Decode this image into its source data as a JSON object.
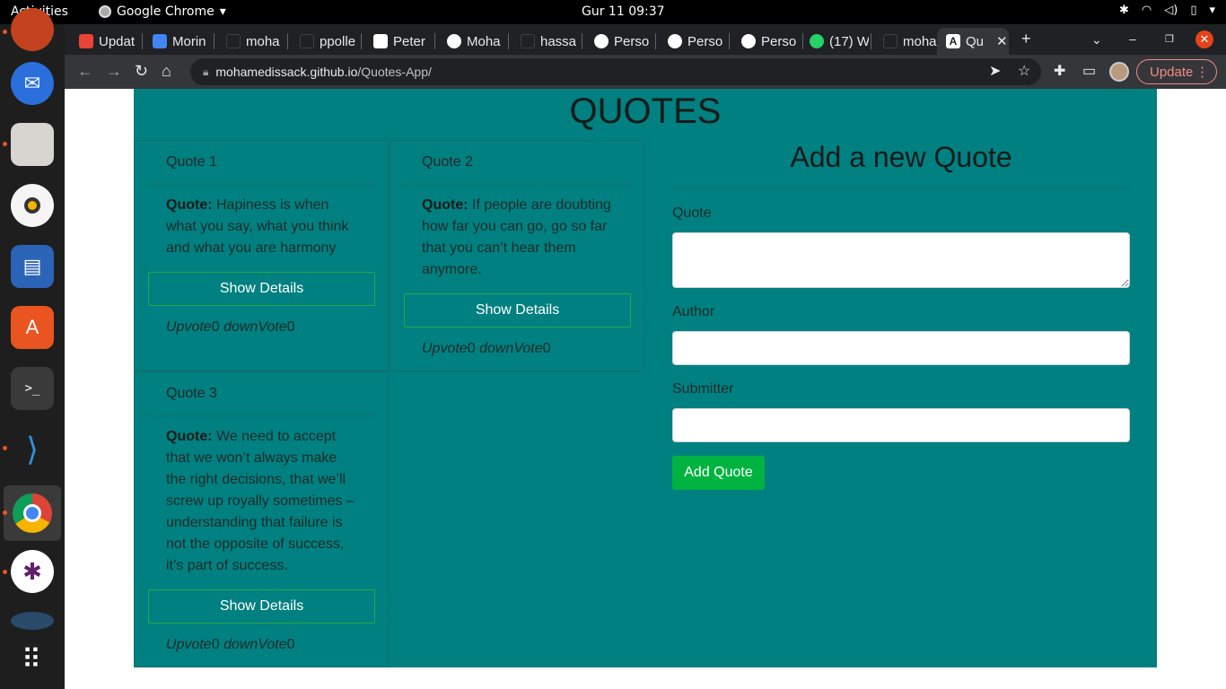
{
  "topbar": {
    "activities": "Activities",
    "app_name": "Google Chrome",
    "clock": "Gur 11  09:37"
  },
  "dock": {
    "items": [
      "firefox-icon",
      "thunderbird-icon",
      "files-icon",
      "rhythmbox-icon",
      "writer-icon",
      "software-icon",
      "terminal-icon",
      "vscode-icon",
      "chrome-icon",
      "slack-icon",
      "apps-grid-icon"
    ]
  },
  "browser": {
    "tabs": [
      {
        "label": "Updat",
        "color": "#ea4335"
      },
      {
        "label": "Morin",
        "color": "#4285f4"
      },
      {
        "label": "moha",
        "color": "#202124"
      },
      {
        "label": "ppolle",
        "color": "#202124"
      },
      {
        "label": "Peter",
        "color": "#ffffff"
      },
      {
        "label": "Moha",
        "color": "#ffffff"
      },
      {
        "label": "hassa",
        "color": "#202124"
      },
      {
        "label": "Perso",
        "color": "#ffffff"
      },
      {
        "label": "Perso",
        "color": "#ffffff"
      },
      {
        "label": "Perso",
        "color": "#ffffff"
      },
      {
        "label": "(17) W",
        "color": "#25d366"
      },
      {
        "label": "moha",
        "color": "#202124"
      },
      {
        "label": "Qu",
        "color": "#ffffff",
        "active": true
      }
    ],
    "url_host": "mohamedissack.github.io",
    "url_path": "/Quotes-App/",
    "update_label": "Update"
  },
  "app": {
    "title": "QUOTES",
    "details_label": "Show Details",
    "quote_prefix": "Quote:",
    "upvote_label": "Upvote",
    "downvote_label": "downVote",
    "quotes": [
      {
        "title": "Quote 1",
        "text": "Hapiness is when what you say, what you think and what you are harmony",
        "upvotes": "0",
        "downvotes": "0"
      },
      {
        "title": "Quote 2",
        "text": "If people are doubting how far you can go, go so far that you can’t hear them anymore.",
        "upvotes": "0",
        "downvotes": "0"
      },
      {
        "title": "Quote 3",
        "text": "We need to accept that we won’t always make the right decisions, that we’ll screw up royally sometimes – understanding that failure is not the opposite of success, it’s part of success.",
        "upvotes": "0",
        "downvotes": "0"
      }
    ],
    "form": {
      "title": "Add a new Quote",
      "quote_label": "Quote",
      "quote_value": "",
      "author_label": "Author",
      "author_value": "",
      "submitter_label": "Submitter",
      "submitter_value": "",
      "submit_label": "Add Quote"
    }
  },
  "colors": {
    "app_bg": "#008080",
    "button_green": "#00b341",
    "chrome_dark": "#202124"
  }
}
